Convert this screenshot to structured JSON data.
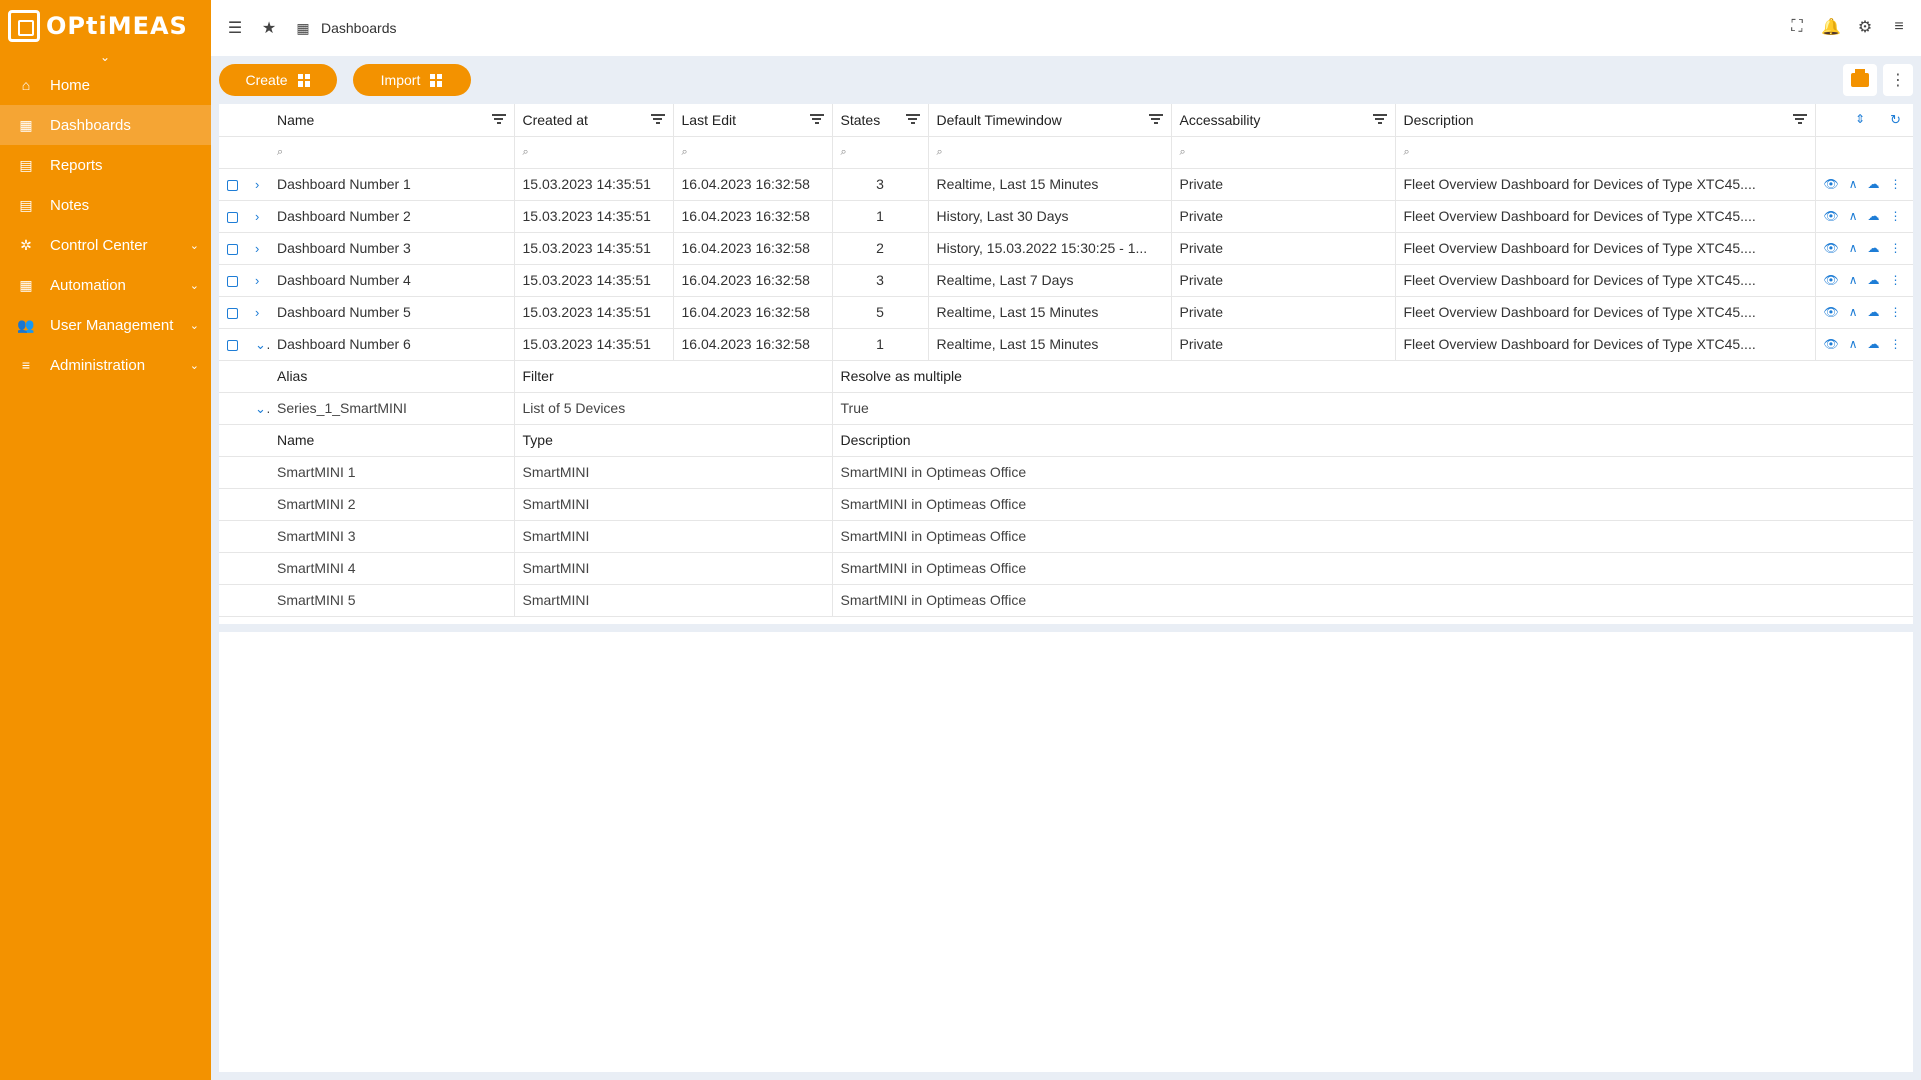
{
  "app": {
    "logo_text": "OPtiMEAS"
  },
  "sidebar": {
    "items": [
      {
        "label": "Home",
        "icon": "home-icon",
        "glyph": "⌂"
      },
      {
        "label": "Dashboards",
        "icon": "dashboard-icon",
        "glyph": "▦"
      },
      {
        "label": "Reports",
        "icon": "document-icon",
        "glyph": "▤"
      },
      {
        "label": "Notes",
        "icon": "notes-icon",
        "glyph": "▤"
      },
      {
        "label": "Control Center",
        "icon": "network-icon",
        "glyph": "✲"
      },
      {
        "label": "Automation",
        "icon": "calendar-icon",
        "glyph": "▦"
      },
      {
        "label": "User Management",
        "icon": "users-icon",
        "glyph": "👥"
      },
      {
        "label": "Administration",
        "icon": "list-icon",
        "glyph": "≡"
      }
    ]
  },
  "topbar": {
    "breadcrumb": "Dashboards"
  },
  "toolbar": {
    "create_label": "Create",
    "import_label": "Import"
  },
  "table": {
    "headers": [
      "Name",
      "Created at",
      "Last Edit",
      "States",
      "Default Timewindow",
      "Accessability",
      "Description"
    ],
    "rows": [
      {
        "name": "Dashboard Number 1",
        "created": "15.03.2023 14:35:51",
        "edited": "16.04.2023 16:32:58",
        "states": "3",
        "timewindow": "Realtime, Last 15 Minutes",
        "access": "Private",
        "description": "Fleet Overview Dashboard for Devices of Type XTC45....",
        "expanded": false
      },
      {
        "name": "Dashboard Number 2",
        "created": "15.03.2023 14:35:51",
        "edited": "16.04.2023 16:32:58",
        "states": "1",
        "timewindow": "History, Last 30 Days",
        "access": "Private",
        "description": "Fleet Overview Dashboard for Devices of Type XTC45....",
        "expanded": false
      },
      {
        "name": "Dashboard Number 3",
        "created": "15.03.2023 14:35:51",
        "edited": "16.04.2023 16:32:58",
        "states": "2",
        "timewindow": "History, 15.03.2022 15:30:25 - 1...",
        "access": "Private",
        "description": "Fleet Overview Dashboard for Devices of Type XTC45....",
        "expanded": false
      },
      {
        "name": "Dashboard Number 4",
        "created": "15.03.2023 14:35:51",
        "edited": "16.04.2023 16:32:58",
        "states": "3",
        "timewindow": "Realtime, Last 7 Days",
        "access": "Private",
        "description": "Fleet Overview Dashboard for Devices of Type XTC45....",
        "expanded": false
      },
      {
        "name": "Dashboard Number 5",
        "created": "15.03.2023 14:35:51",
        "edited": "16.04.2023 16:32:58",
        "states": "5",
        "timewindow": "Realtime, Last 15 Minutes",
        "access": "Private",
        "description": "Fleet Overview Dashboard for Devices of Type XTC45....",
        "expanded": false
      },
      {
        "name": "Dashboard Number 6",
        "created": "15.03.2023 14:35:51",
        "edited": "16.04.2023 16:32:58",
        "states": "1",
        "timewindow": "Realtime, Last 15 Minutes",
        "access": "Private",
        "description": "Fleet Overview Dashboard for Devices of Type XTC45....",
        "expanded": true
      }
    ],
    "alias_headers": [
      "Alias",
      "Filter",
      "Resolve as multiple"
    ],
    "alias": {
      "name": "Series_1_SmartMINI",
      "filter": "List of 5 Devices",
      "resolve": "True"
    },
    "device_headers": [
      "Name",
      "Type",
      "Description"
    ],
    "devices": [
      {
        "name": "SmartMINI 1",
        "type": "SmartMINI",
        "description": "SmartMINI in Optimeas Office"
      },
      {
        "name": "SmartMINI 2",
        "type": "SmartMINI",
        "description": "SmartMINI in Optimeas Office"
      },
      {
        "name": "SmartMINI 3",
        "type": "SmartMINI",
        "description": "SmartMINI in Optimeas Office"
      },
      {
        "name": "SmartMINI 4",
        "type": "SmartMINI",
        "description": "SmartMINI in Optimeas Office"
      },
      {
        "name": "SmartMINI 5",
        "type": "SmartMINI",
        "description": "SmartMINI in Optimeas Office"
      }
    ]
  },
  "colors": {
    "brand": "#f39200",
    "accent": "#1e7dd6"
  }
}
